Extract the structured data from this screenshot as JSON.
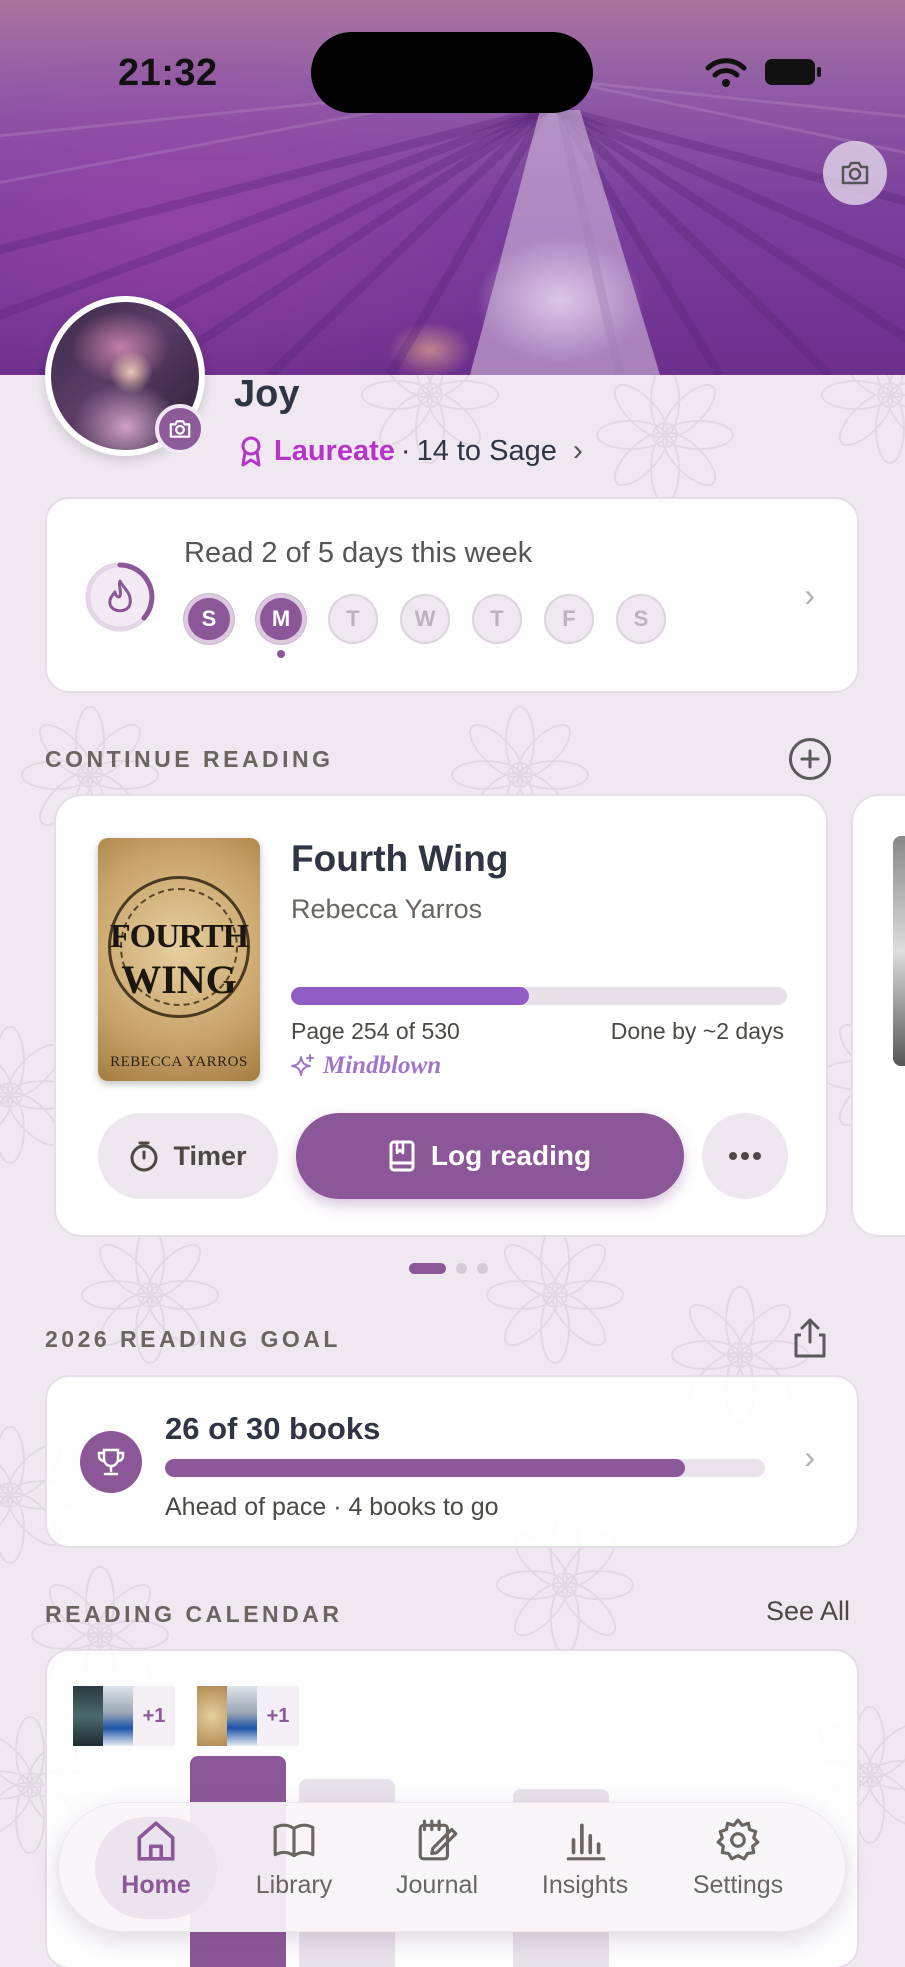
{
  "status_bar": {
    "time": "21:32"
  },
  "profile": {
    "name": "Joy",
    "rank": "Laureate",
    "rank_progress": "14 to Sage",
    "separator": "·"
  },
  "streak": {
    "title": "Read 2 of 5 days this week",
    "days": [
      {
        "label": "S",
        "done": true
      },
      {
        "label": "M",
        "done": true,
        "today": true
      },
      {
        "label": "T",
        "done": false
      },
      {
        "label": "W",
        "done": false
      },
      {
        "label": "T",
        "done": false
      },
      {
        "label": "F",
        "done": false
      },
      {
        "label": "S",
        "done": false
      }
    ]
  },
  "continue_reading": {
    "header": "CONTINUE READING",
    "book": {
      "title": "Fourth Wing",
      "author": "Rebecca Yarros",
      "cover_lines": [
        "FOURTH",
        "WING"
      ],
      "cover_author": "REBECCA YARROS",
      "page_text": "Page 254 of 530",
      "progress_fraction": 0.479,
      "done_by": "Done by ~2 days",
      "mood": "Mindblown"
    },
    "buttons": {
      "timer": "Timer",
      "log": "Log reading"
    },
    "page_count": 3,
    "active_page": 0
  },
  "goal": {
    "header": "2026 READING GOAL",
    "title": "26 of 30 books",
    "progress_fraction": 0.867,
    "subtitle": "Ahead of pace · 4 books to go"
  },
  "calendar": {
    "header": "READING CALENDAR",
    "see_all": "See All",
    "more_badges": [
      "+1",
      "+1"
    ]
  },
  "tabs": [
    {
      "label": "Home",
      "icon": "home-icon",
      "active": true
    },
    {
      "label": "Library",
      "icon": "book-open-icon",
      "active": false
    },
    {
      "label": "Journal",
      "icon": "journal-icon",
      "active": false
    },
    {
      "label": "Insights",
      "icon": "bar-chart-icon",
      "active": false
    },
    {
      "label": "Settings",
      "icon": "gear-icon",
      "active": false
    }
  ],
  "colors": {
    "accent": "#8c5799",
    "rank": "#b535c9",
    "progress": "#8f5dc4"
  }
}
